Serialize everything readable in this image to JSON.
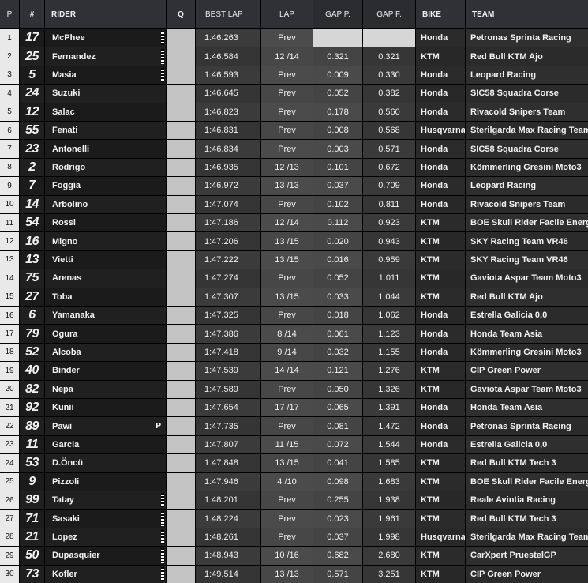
{
  "headers": {
    "p": "P",
    "num": "#",
    "rider": "RIDER",
    "q": "Q",
    "best_lap": "BEST LAP",
    "lap": "LAP",
    "gap_p": "GAP P.",
    "gap_f": "GAP F.",
    "bike": "BIKE",
    "team": "TEAM"
  },
  "rows": [
    {
      "p": "1",
      "num": "17",
      "rider": "McPhee",
      "best": "1:46.263",
      "lap": "Prev",
      "gap_p": "",
      "gap_f": "",
      "bike": "Honda",
      "team": "Petronas Sprinta Racing",
      "flag": true,
      "note": ""
    },
    {
      "p": "2",
      "num": "25",
      "rider": "Fernandez",
      "best": "1:46.584",
      "lap": "12 /14",
      "gap_p": "0.321",
      "gap_f": "0.321",
      "bike": "KTM",
      "team": "Red Bull KTM Ajo",
      "flag": true,
      "note": ""
    },
    {
      "p": "3",
      "num": "5",
      "rider": "Masia",
      "best": "1:46.593",
      "lap": "Prev",
      "gap_p": "0.009",
      "gap_f": "0.330",
      "bike": "Honda",
      "team": "Leopard Racing",
      "flag": true,
      "note": ""
    },
    {
      "p": "4",
      "num": "24",
      "rider": "Suzuki",
      "best": "1:46.645",
      "lap": "Prev",
      "gap_p": "0.052",
      "gap_f": "0.382",
      "bike": "Honda",
      "team": "SIC58 Squadra Corse",
      "flag": false,
      "note": ""
    },
    {
      "p": "5",
      "num": "12",
      "rider": "Salac",
      "best": "1:46.823",
      "lap": "Prev",
      "gap_p": "0.178",
      "gap_f": "0.560",
      "bike": "Honda",
      "team": "Rivacold Snipers Team",
      "flag": false,
      "note": ""
    },
    {
      "p": "6",
      "num": "55",
      "rider": "Fenati",
      "best": "1:46.831",
      "lap": "Prev",
      "gap_p": "0.008",
      "gap_f": "0.568",
      "bike": "Husqvarna",
      "team": "Sterilgarda Max Racing Team",
      "flag": false,
      "note": ""
    },
    {
      "p": "7",
      "num": "23",
      "rider": "Antonelli",
      "best": "1:46.834",
      "lap": "Prev",
      "gap_p": "0.003",
      "gap_f": "0.571",
      "bike": "Honda",
      "team": "SIC58 Squadra Corse",
      "flag": false,
      "note": ""
    },
    {
      "p": "8",
      "num": "2",
      "rider": "Rodrigo",
      "best": "1:46.935",
      "lap": "12 /13",
      "gap_p": "0.101",
      "gap_f": "0.672",
      "bike": "Honda",
      "team": "Kömmerling Gresini Moto3",
      "flag": false,
      "note": ""
    },
    {
      "p": "9",
      "num": "7",
      "rider": "Foggia",
      "best": "1:46.972",
      "lap": "13 /13",
      "gap_p": "0.037",
      "gap_f": "0.709",
      "bike": "Honda",
      "team": "Leopard Racing",
      "flag": false,
      "note": ""
    },
    {
      "p": "10",
      "num": "14",
      "rider": "Arbolino",
      "best": "1:47.074",
      "lap": "Prev",
      "gap_p": "0.102",
      "gap_f": "0.811",
      "bike": "Honda",
      "team": "Rivacold Snipers Team",
      "flag": false,
      "note": ""
    },
    {
      "p": "11",
      "num": "54",
      "rider": "Rossi",
      "best": "1:47.186",
      "lap": "12 /14",
      "gap_p": "0.112",
      "gap_f": "0.923",
      "bike": "KTM",
      "team": "BOE Skull Rider Facile Energy",
      "flag": false,
      "note": ""
    },
    {
      "p": "12",
      "num": "16",
      "rider": "Migno",
      "best": "1:47.206",
      "lap": "13 /15",
      "gap_p": "0.020",
      "gap_f": "0.943",
      "bike": "KTM",
      "team": "SKY Racing Team VR46",
      "flag": false,
      "note": ""
    },
    {
      "p": "13",
      "num": "13",
      "rider": "Vietti",
      "best": "1:47.222",
      "lap": "13 /15",
      "gap_p": "0.016",
      "gap_f": "0.959",
      "bike": "KTM",
      "team": "SKY Racing Team VR46",
      "flag": false,
      "note": ""
    },
    {
      "p": "14",
      "num": "75",
      "rider": "Arenas",
      "best": "1:47.274",
      "lap": "Prev",
      "gap_p": "0.052",
      "gap_f": "1.011",
      "bike": "KTM",
      "team": "Gaviota Aspar Team Moto3",
      "flag": false,
      "note": ""
    },
    {
      "p": "15",
      "num": "27",
      "rider": "Toba",
      "best": "1:47.307",
      "lap": "13 /15",
      "gap_p": "0.033",
      "gap_f": "1.044",
      "bike": "KTM",
      "team": "Red Bull KTM Ajo",
      "flag": false,
      "note": ""
    },
    {
      "p": "16",
      "num": "6",
      "rider": "Yamanaka",
      "best": "1:47.325",
      "lap": "Prev",
      "gap_p": "0.018",
      "gap_f": "1.062",
      "bike": "Honda",
      "team": "Estrella Galicia 0,0",
      "flag": false,
      "note": ""
    },
    {
      "p": "17",
      "num": "79",
      "rider": "Ogura",
      "best": "1:47.386",
      "lap": "8 /14",
      "gap_p": "0.061",
      "gap_f": "1.123",
      "bike": "Honda",
      "team": "Honda Team Asia",
      "flag": false,
      "note": ""
    },
    {
      "p": "18",
      "num": "52",
      "rider": "Alcoba",
      "best": "1:47.418",
      "lap": "9 /14",
      "gap_p": "0.032",
      "gap_f": "1.155",
      "bike": "Honda",
      "team": "Kömmerling Gresini Moto3",
      "flag": false,
      "note": ""
    },
    {
      "p": "19",
      "num": "40",
      "rider": "Binder",
      "best": "1:47.539",
      "lap": "14 /14",
      "gap_p": "0.121",
      "gap_f": "1.276",
      "bike": "KTM",
      "team": "CIP Green Power",
      "flag": false,
      "note": ""
    },
    {
      "p": "20",
      "num": "82",
      "rider": "Nepa",
      "best": "1:47.589",
      "lap": "Prev",
      "gap_p": "0.050",
      "gap_f": "1.326",
      "bike": "KTM",
      "team": "Gaviota Aspar Team Moto3",
      "flag": false,
      "note": ""
    },
    {
      "p": "21",
      "num": "92",
      "rider": "Kunii",
      "best": "1:47.654",
      "lap": "17 /17",
      "gap_p": "0.065",
      "gap_f": "1.391",
      "bike": "Honda",
      "team": "Honda Team Asia",
      "flag": false,
      "note": ""
    },
    {
      "p": "22",
      "num": "89",
      "rider": "Pawi",
      "best": "1:47.735",
      "lap": "Prev",
      "gap_p": "0.081",
      "gap_f": "1.472",
      "bike": "Honda",
      "team": "Petronas Sprinta Racing",
      "flag": false,
      "note": "P"
    },
    {
      "p": "23",
      "num": "11",
      "rider": "Garcia",
      "best": "1:47.807",
      "lap": "11 /15",
      "gap_p": "0.072",
      "gap_f": "1.544",
      "bike": "Honda",
      "team": "Estrella Galicia 0,0",
      "flag": false,
      "note": ""
    },
    {
      "p": "24",
      "num": "53",
      "rider": "D.Öncü",
      "best": "1:47.848",
      "lap": "13 /15",
      "gap_p": "0.041",
      "gap_f": "1.585",
      "bike": "KTM",
      "team": "Red Bull KTM Tech 3",
      "flag": false,
      "note": ""
    },
    {
      "p": "25",
      "num": "9",
      "rider": "Pizzoli",
      "best": "1:47.946",
      "lap": "4 /10",
      "gap_p": "0.098",
      "gap_f": "1.683",
      "bike": "KTM",
      "team": "BOE Skull Rider Facile Energy",
      "flag": false,
      "note": ""
    },
    {
      "p": "26",
      "num": "99",
      "rider": "Tatay",
      "best": "1:48.201",
      "lap": "Prev",
      "gap_p": "0.255",
      "gap_f": "1.938",
      "bike": "KTM",
      "team": "Reale Avintia Racing",
      "flag": true,
      "note": ""
    },
    {
      "p": "27",
      "num": "71",
      "rider": "Sasaki",
      "best": "1:48.224",
      "lap": "Prev",
      "gap_p": "0.023",
      "gap_f": "1.961",
      "bike": "KTM",
      "team": "Red Bull KTM Tech 3",
      "flag": true,
      "note": ""
    },
    {
      "p": "28",
      "num": "21",
      "rider": "Lopez",
      "best": "1:48.261",
      "lap": "Prev",
      "gap_p": "0.037",
      "gap_f": "1.998",
      "bike": "Husqvarna",
      "team": "Sterilgarda Max Racing Team",
      "flag": true,
      "note": ""
    },
    {
      "p": "29",
      "num": "50",
      "rider": "Dupasquier",
      "best": "1:48.943",
      "lap": "10 /16",
      "gap_p": "0.682",
      "gap_f": "2.680",
      "bike": "KTM",
      "team": "CarXpert PruestelGP",
      "flag": true,
      "note": ""
    },
    {
      "p": "30",
      "num": "73",
      "rider": "Kofler",
      "best": "1:49.514",
      "lap": "13 /13",
      "gap_p": "0.571",
      "gap_f": "3.251",
      "bike": "KTM",
      "team": "CIP Green Power",
      "flag": true,
      "note": ""
    }
  ]
}
